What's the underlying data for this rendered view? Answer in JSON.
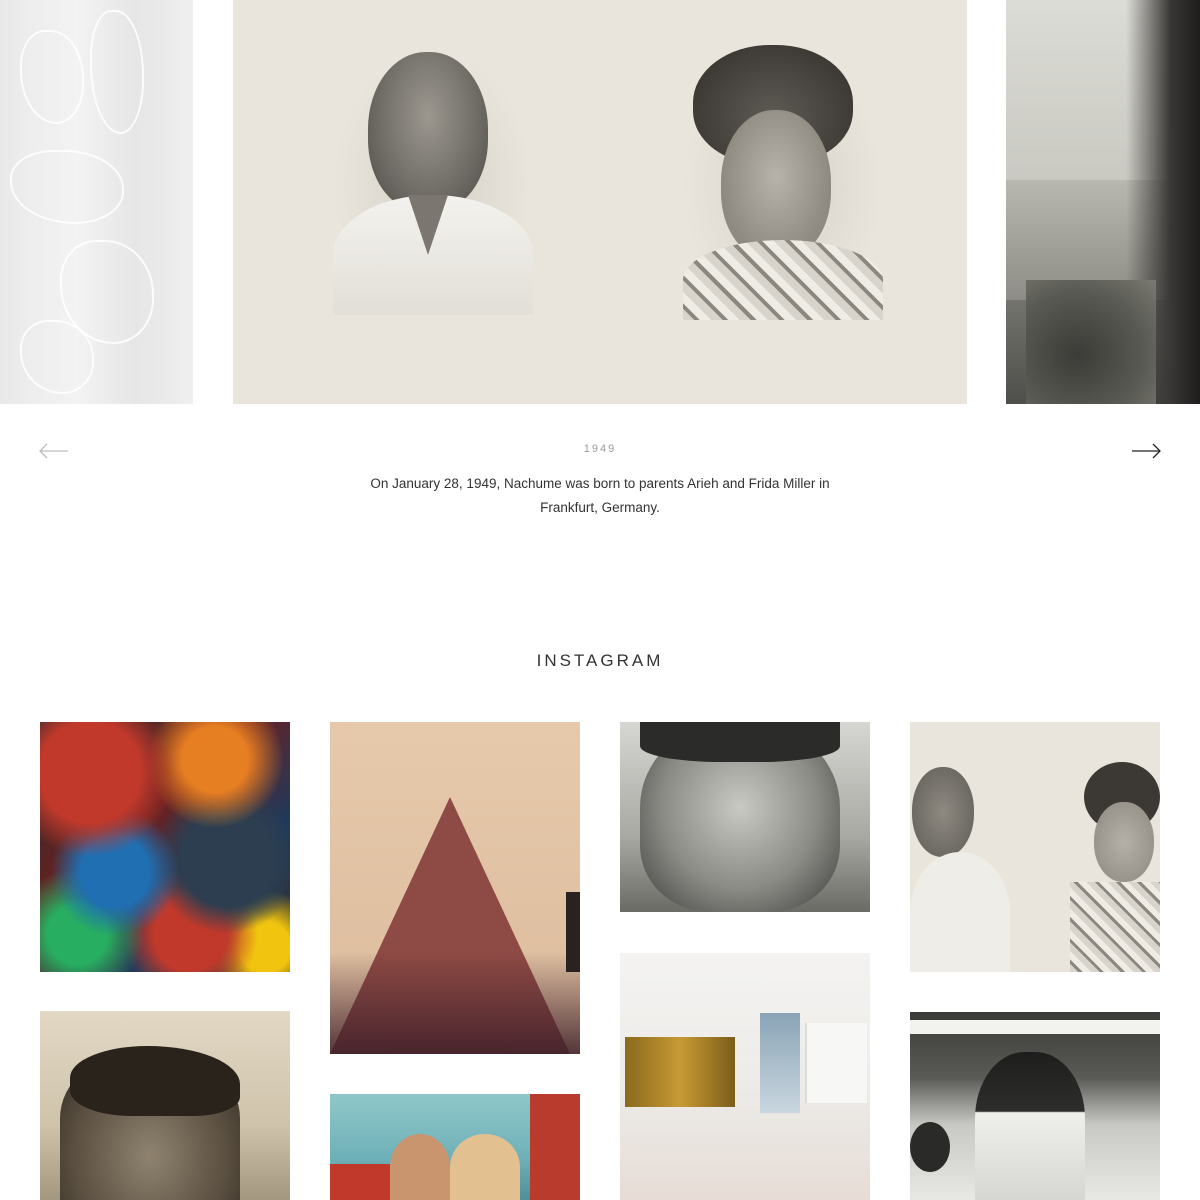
{
  "slider": {
    "year": "1949",
    "caption": "On January 28, 1949, Nachume was born to parents Arieh and Frida Miller in Frankfurt, Germany.",
    "prev_icon": "arrow-left-icon",
    "next_icon": "arrow-right-icon"
  },
  "instagram": {
    "title": "INSTAGRAM",
    "posts": [
      {
        "subject": "abstract-painting"
      },
      {
        "subject": "red-triangle-photo"
      },
      {
        "subject": "portrait-man"
      },
      {
        "subject": "couple-portraits"
      },
      {
        "subject": "young-man-portrait"
      },
      {
        "subject": "group-on-boat"
      },
      {
        "subject": "gallery-interior"
      },
      {
        "subject": "man-in-gallery"
      }
    ]
  },
  "colors": {
    "accent_text": "#333333",
    "muted_text": "#9a9a9a",
    "sepia": "#e9e5dc"
  }
}
